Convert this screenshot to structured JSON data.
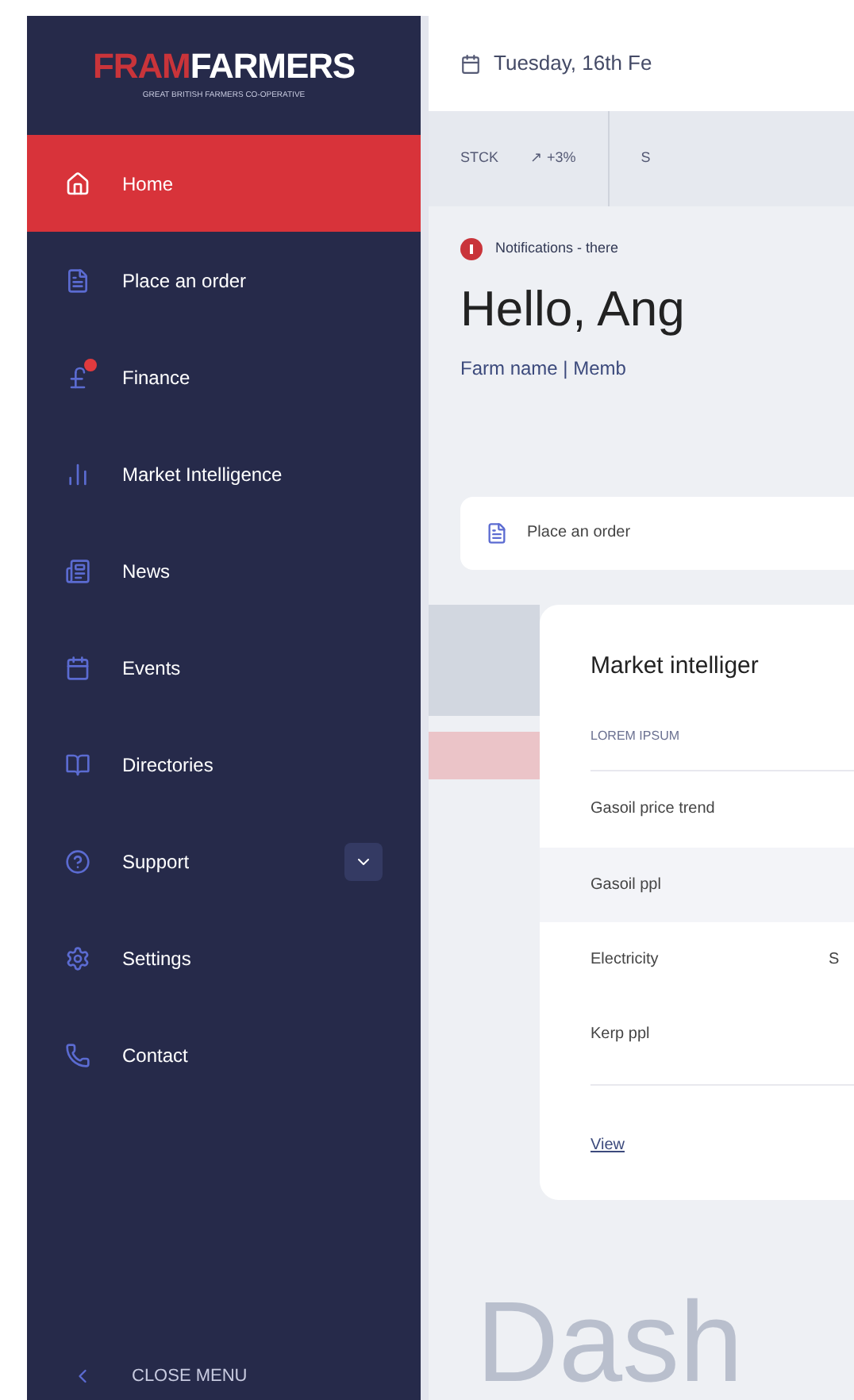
{
  "logo": {
    "brand_first": "FRAM",
    "brand_second": "FARMERS",
    "tagline": "GREAT BRITISH FARMERS CO-OPERATIVE"
  },
  "sidebar": {
    "items": [
      {
        "label": "Home",
        "kind": "home",
        "selected": true
      },
      {
        "label": "Place an order",
        "kind": "order",
        "selected": false
      },
      {
        "label": "Finance",
        "kind": "finance",
        "selected": false,
        "badge": true
      },
      {
        "label": "Market Intelligence",
        "kind": "chart",
        "selected": false
      },
      {
        "label": "News",
        "kind": "news",
        "selected": false
      },
      {
        "label": "Events",
        "kind": "calendar",
        "selected": false
      },
      {
        "label": "Directories",
        "kind": "directory",
        "selected": false
      },
      {
        "label": "Support",
        "kind": "support",
        "selected": false,
        "expandable": true,
        "expanded": false
      },
      {
        "label": "Settings",
        "kind": "settings",
        "selected": false
      },
      {
        "label": "Contact",
        "kind": "phone",
        "selected": false
      }
    ],
    "close_menu": "CLOSE MENU"
  },
  "date": "Tuesday, 16th Fe",
  "ticker": [
    {
      "symbol": "STCK",
      "change": "↗ +3%"
    },
    {
      "symbol": "S"
    }
  ],
  "notification": "Notifications - there",
  "greeting": "Hello, Ang",
  "subtitle": "Farm name | Memb",
  "quick_action": "Place an order",
  "market_card": {
    "title": "Market intelliger",
    "column_1": "LOREM IPSUM",
    "rows": [
      {
        "name": "Gasoil price trend",
        "highlighted": false
      },
      {
        "name": "Gasoil ppl",
        "highlighted": true
      },
      {
        "name": "Electricity",
        "highlighted": false,
        "column_2": "S"
      },
      {
        "name": "Kerp ppl",
        "highlighted": false
      }
    ],
    "link": "View"
  },
  "page_heading": "Dash"
}
